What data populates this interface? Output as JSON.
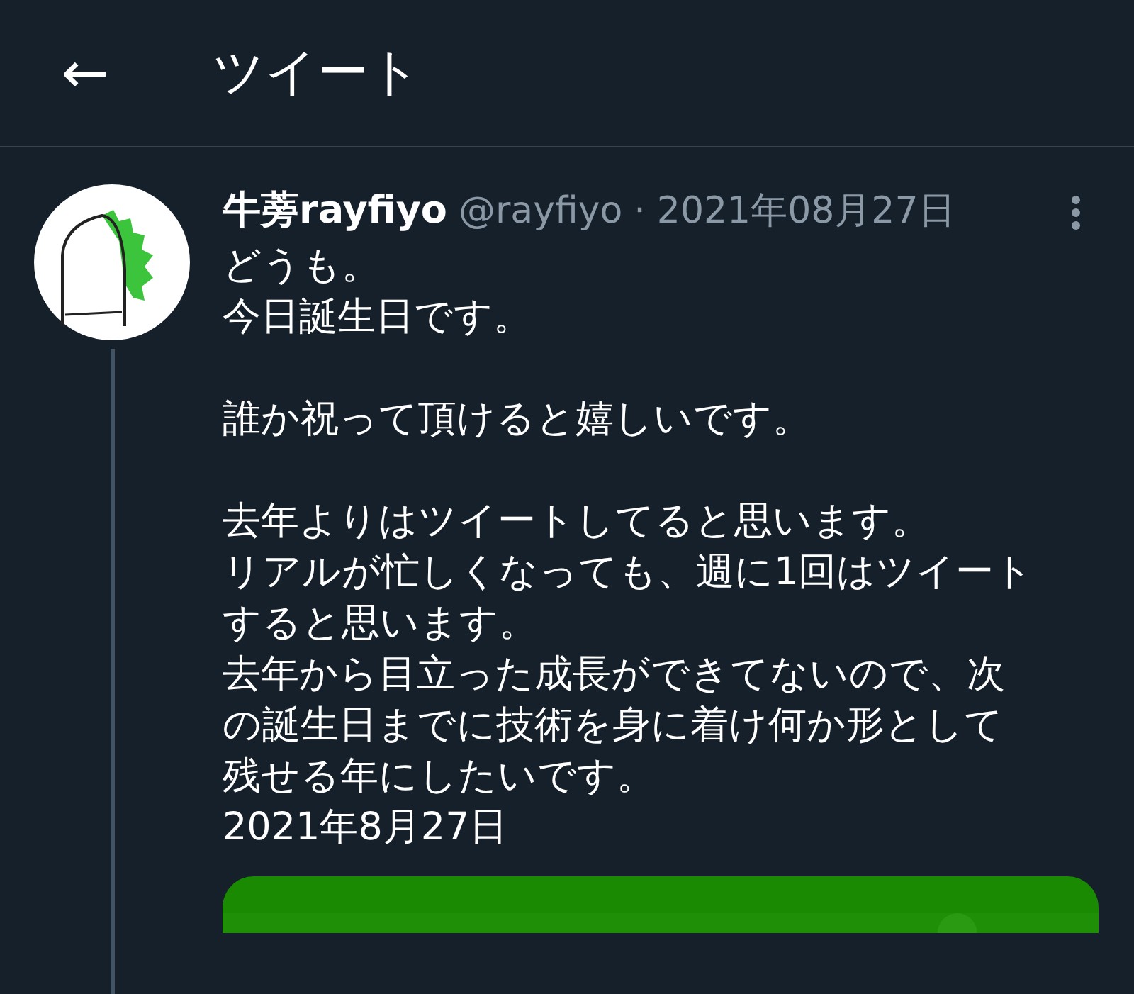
{
  "header": {
    "back": "←",
    "title": "ツイート"
  },
  "tweet": {
    "display_name": "牛蒡rayfiyo",
    "handle": "@rayfiyo",
    "separator": "·",
    "date": "2021年08月27日",
    "paragraphs": [
      [
        "どうも。",
        "今日誕生日です。"
      ],
      [
        "誰か祝って頂けると嬉しいです。"
      ],
      [
        "去年よりはツイートしてると思います。",
        "リアルが忙しくなっても、週に1回はツイート",
        "すると思います。",
        "去年から目立った成長ができてないので、次",
        "の誕生日までに技術を身に着け何か形として",
        "残せる年にしたいです。",
        "2021年8月27日"
      ]
    ],
    "attachment": {
      "kind": "picture"
    }
  }
}
